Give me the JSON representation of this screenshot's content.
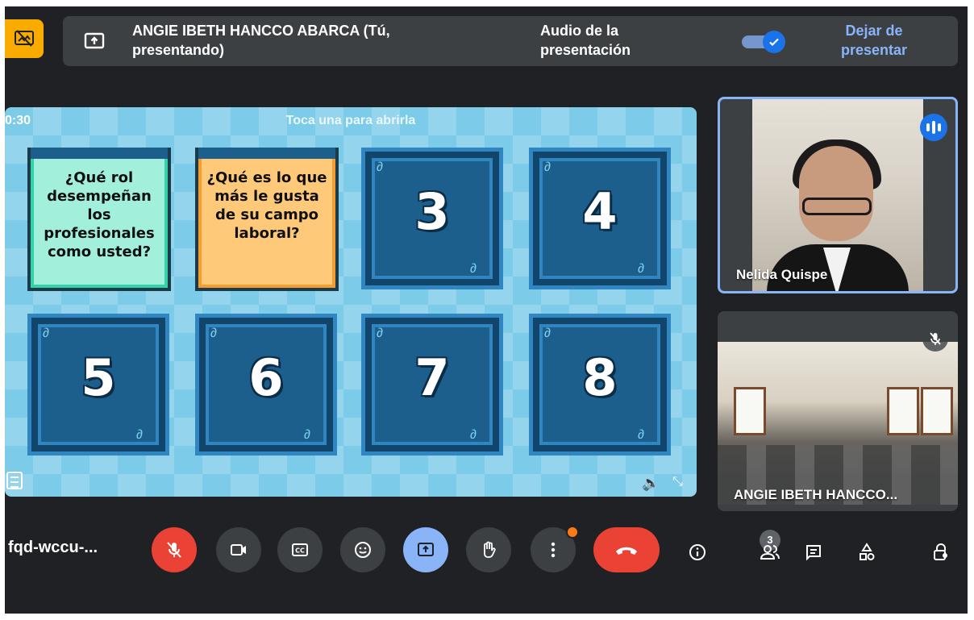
{
  "top_bar": {
    "presenter_text": "ANGIE IBETH HANCCO ABARCA (Tú, presentando)",
    "audio_label": "Audio de la presentación",
    "audio_toggle_on": true,
    "stop_button": "Dejar de presentar"
  },
  "slide": {
    "timer": "0:30",
    "caption": "Toca una para abrirla",
    "cards": [
      {
        "type": "open",
        "color": "green",
        "text": "¿Qué rol desempeñan los profesionales como usted?"
      },
      {
        "type": "open",
        "color": "orange",
        "text": "¿Qué es lo que más le gusta de su campo laboral?"
      },
      {
        "type": "closed",
        "number": "3"
      },
      {
        "type": "closed",
        "number": "4"
      },
      {
        "type": "closed",
        "number": "5"
      },
      {
        "type": "closed",
        "number": "6"
      },
      {
        "type": "closed",
        "number": "7"
      },
      {
        "type": "closed",
        "number": "8"
      }
    ]
  },
  "participants": [
    {
      "name": "Nelida Quispe",
      "speaking": true,
      "pinned_active": true
    },
    {
      "name": "ANGIE IBETH HANCCO...",
      "muted": true
    }
  ],
  "bottom_bar": {
    "meeting_code": "fqd-wccu-...",
    "people_count": "3",
    "controls": [
      "mic-off",
      "camera",
      "captions",
      "reactions",
      "present",
      "raise-hand",
      "more-options",
      "end-call"
    ],
    "right_controls": [
      "info",
      "people",
      "chat",
      "activities",
      "host-controls"
    ]
  },
  "colors": {
    "background": "#202124",
    "panel": "#3c4043",
    "accent_blue": "#8ab4f8",
    "danger_red": "#ea4335",
    "presenting_yellow": "#f9ab00"
  }
}
